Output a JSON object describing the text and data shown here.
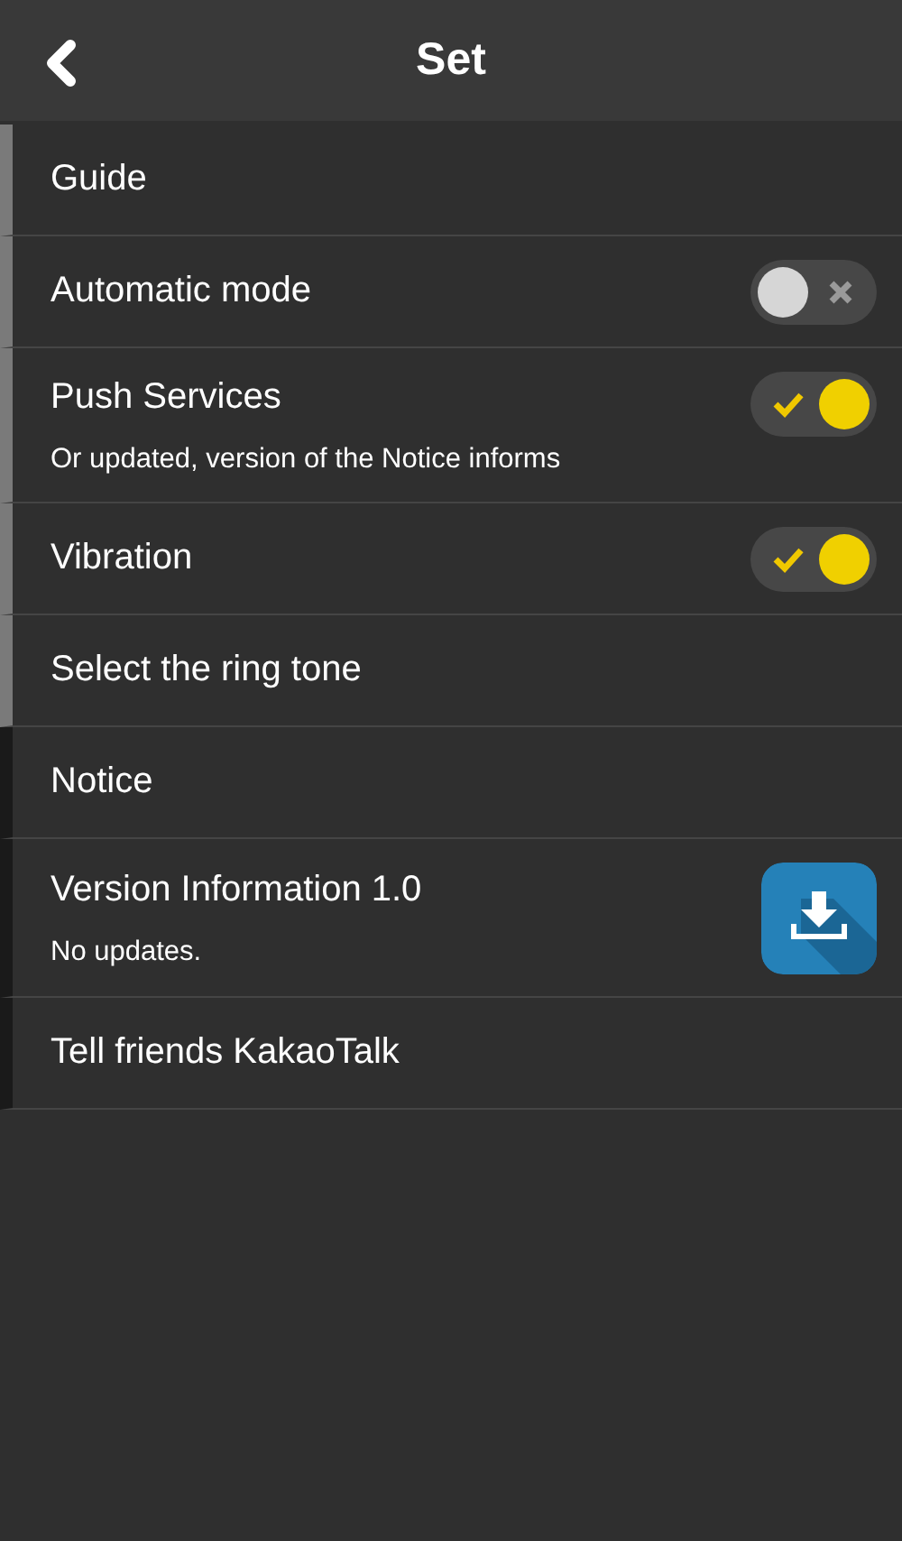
{
  "header": {
    "title": "Set"
  },
  "items": [
    {
      "kind": "plain",
      "label": "Guide",
      "color": "#7a7a7a"
    },
    {
      "kind": "toggle",
      "label": "Automatic mode",
      "on": false,
      "color": "#7a7a7a"
    },
    {
      "kind": "toggle",
      "label": "Push Services",
      "note": "Or updated, version of the Notice informs",
      "on": true,
      "color": "#7a7a7a"
    },
    {
      "kind": "toggle",
      "label": "Vibration",
      "on": true,
      "color": "#7a7a7a"
    },
    {
      "kind": "plain",
      "label": "Select the ring tone",
      "color": "#7a7a7a"
    },
    {
      "kind": "plain",
      "label": "Notice",
      "color": "#1a1a1a"
    },
    {
      "kind": "download",
      "label": "Version Information 1.0",
      "note": "No updates.",
      "color": "#1a1a1a"
    },
    {
      "kind": "plain",
      "label": "Tell friends KakaoTalk",
      "color": "#1a1a1a"
    }
  ]
}
